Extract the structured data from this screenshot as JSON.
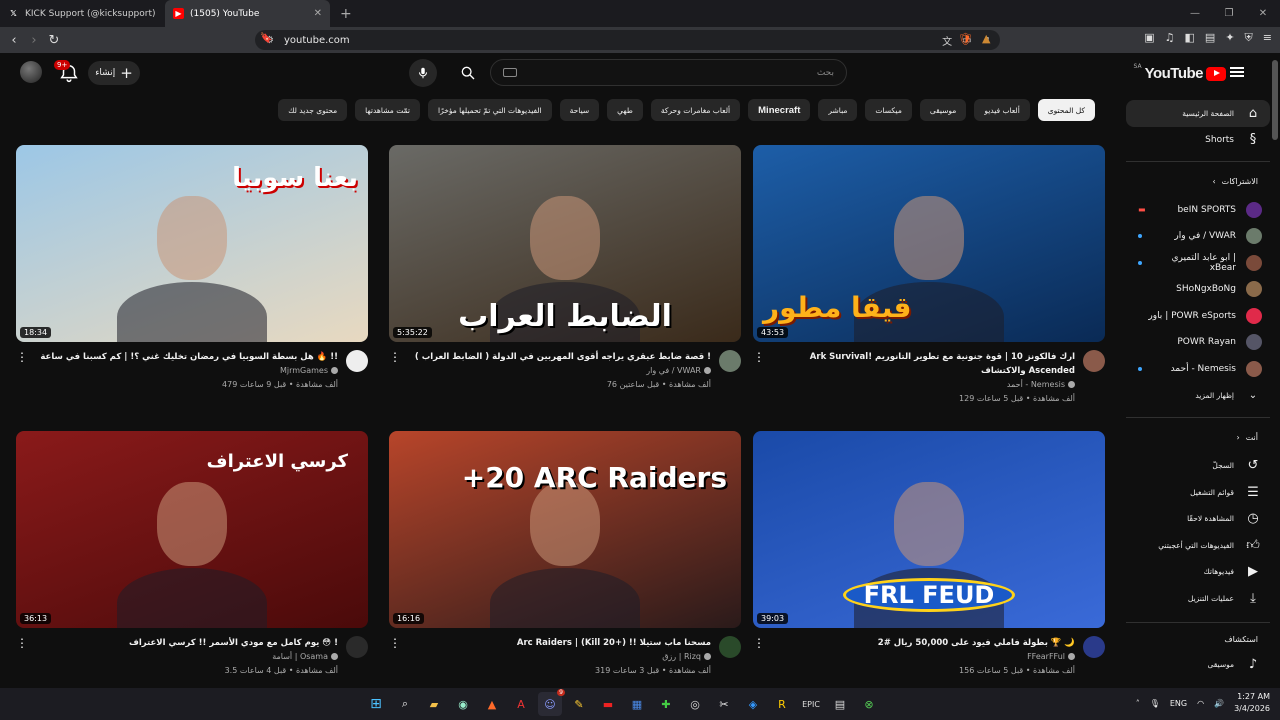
{
  "browser": {
    "tabs": [
      {
        "title": "KICK Support (@kicksupport) / X",
        "favicon": "x-icon"
      },
      {
        "title": "(1505) YouTube",
        "favicon": "youtube-icon",
        "active": true
      }
    ],
    "url": "youtube.com"
  },
  "masthead": {
    "logo_text": "YouTube",
    "country_code": "SA",
    "search_placeholder": "بحث",
    "create_label": "إنشاء",
    "notifications_badge": "9+"
  },
  "chips": [
    {
      "label": "كل المحتوى",
      "active": true
    },
    {
      "label": "ألعاب فيديو"
    },
    {
      "label": "موسيقى"
    },
    {
      "label": "ميكسات"
    },
    {
      "label": "مباشر"
    },
    {
      "label": "Minecraft"
    },
    {
      "label": "ألعاب مغامرات وحركة"
    },
    {
      "label": "طهي"
    },
    {
      "label": "سياحة"
    },
    {
      "label": "الفيديوهات التي تمّ تحميلها مؤخرًا"
    },
    {
      "label": "تمّت مشاهدتها"
    },
    {
      "label": "محتوى جديد لك"
    }
  ],
  "sidebar": {
    "home": "الصفحة الرئيسية",
    "shorts": "Shorts",
    "subscriptions_header": "الاشتراكات",
    "subscriptions": [
      {
        "name": "beIN SPORTS",
        "color": "#5b2a86",
        "indicator": "live"
      },
      {
        "name": "في وار / VWAR",
        "color": "#6b7b6b",
        "indicator": "dot"
      },
      {
        "name": "ابو عابد التميري | xBear",
        "color": "#7a4a3a",
        "indicator": "dot"
      },
      {
        "name": "SHoNgxBoNg",
        "color": "#8a6a4a",
        "indicator": ""
      },
      {
        "name": "باور | POWR eSports",
        "color": "#e02a4a",
        "indicator": ""
      },
      {
        "name": "POWR Rayan",
        "color": "#556",
        "indicator": ""
      },
      {
        "name": "أحمد - Nemesis",
        "color": "#8a5a4a",
        "indicator": "dot"
      }
    ],
    "show_more": "إظهار المزيد",
    "you_header": "أنت",
    "you_items": [
      {
        "label": "السجلّ",
        "icon": "history-icon"
      },
      {
        "label": "قوائم التشغيل",
        "icon": "playlist-icon"
      },
      {
        "label": "المشاهدة لاحقًا",
        "icon": "watch-later-icon"
      },
      {
        "label": "الفيديوهات التي أعجبتني",
        "icon": "like-icon"
      },
      {
        "label": "فيديوهاتك",
        "icon": "your-videos-icon"
      },
      {
        "label": "عمليات التنزيل",
        "icon": "download-icon"
      }
    ],
    "explore_header": "استكشاف",
    "explore_items": [
      {
        "label": "موسيقى",
        "icon": "music-icon"
      }
    ]
  },
  "videos": [
    {
      "title": "Ark Survival! ارك فالكونز 10 | قوة جنونية مع تطوير التانوريم والاكتشاف Ascended",
      "channel": "أحمد - Nemesis",
      "stats": "129 ألف مشاهدة • قبل 5 ساعات",
      "duration": "43:53",
      "thumb_text": "قيقا مطور",
      "thumb_colors": [
        "#1d5ea8",
        "#0a2a55"
      ],
      "avatar_color": "#8a5a4a"
    },
    {
      "title": "قصة ضابط عبقري يراجه أقوى المهربين في الدولة ( الضابط العراب ) !",
      "channel": "في وار / VWAR",
      "stats": "76 ألف مشاهدة • قبل ساعتين",
      "duration": "5:35:22",
      "thumb_text": "الضابط العراب",
      "thumb_colors": [
        "#6a6a66",
        "#3a2a1a"
      ],
      "avatar_color": "#6b7b6b"
    },
    {
      "title": "هل بسطة السوبيا في رمضان تخليك غني ؟! | كم كسبنا في ساعة 🔥 !!",
      "channel": "MjrmGames",
      "stats": "479 ألف مشاهدة • قبل 9 ساعات",
      "duration": "18:34",
      "thumb_text": "بعنا سوبيا",
      "thumb_colors": [
        "#9cc7e6",
        "#e8d9c0"
      ],
      "avatar_color": "#eeeeee"
    },
    {
      "title": "بطولة فاملي فيود على 50,000 ريال #2 🏆 🌙",
      "channel": "FFearFFul",
      "stats": "156 ألف مشاهدة • قبل 5 ساعات",
      "duration": "39:03",
      "thumb_text": "FRL FEUD",
      "thumb_colors": [
        "#1a4aa8",
        "#3a6ad8"
      ],
      "avatar_color": "#2a3a8a"
    },
    {
      "title": "Arc Raiders | (Kill 20+) !! مسحنا ماب ستيلا",
      "channel": "رزق | Rizq",
      "stats": "319 ألف مشاهدة • قبل 3 ساعات",
      "duration": "16:16",
      "thumb_text": "+20 ARC Raiders",
      "thumb_colors": [
        "#b8452a",
        "#2a1a1a"
      ],
      "avatar_color": "#2a4a2a"
    },
    {
      "title": "يوم كامل مع مودي الأسمر !! كرسي الاعتراف 😳 !",
      "channel": "أسامة | Osama",
      "stats": "3.5 ألف مشاهدة • قبل 4 ساعات",
      "duration": "36:13",
      "thumb_text": "كرسي الاعتراف",
      "thumb_colors": [
        "#8a1a1a",
        "#4a0a0a"
      ],
      "avatar_color": "#2a2a2a"
    }
  ],
  "taskbar": {
    "lang": "ENG",
    "time": "1:27 AM",
    "date": "3/4/2026",
    "discord_badge": "9"
  }
}
